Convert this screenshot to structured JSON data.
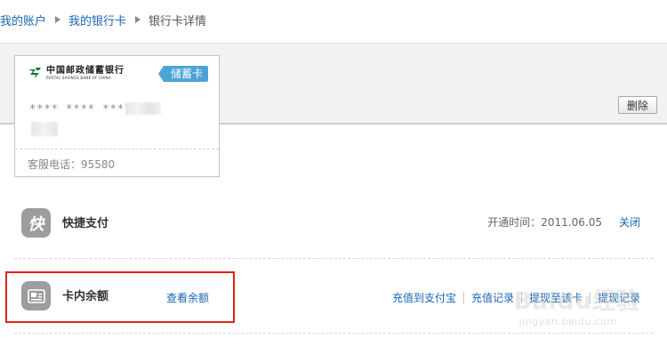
{
  "breadcrumb": {
    "items": [
      {
        "label": "我的账户"
      },
      {
        "label": "我的银行卡"
      },
      {
        "label": "银行卡详情"
      }
    ]
  },
  "toolbar": {
    "delete_label": "删除"
  },
  "card": {
    "bank_name_cn": "中国邮政储蓄银行",
    "bank_name_en": "POSTAL SAVINGS BANK OF CHINA",
    "type_label": "储蓄卡",
    "number_masked": "**** **** ****",
    "service_phone": "客服电话：95580"
  },
  "quick_pay": {
    "title": "快捷支付",
    "icon_char": "快",
    "open_time": "开通时间：2011.06.05",
    "close_label": "关闭"
  },
  "balance": {
    "title": "卡内余额",
    "view_label": "查看余额",
    "actions": [
      {
        "label": "充值到支付宝"
      },
      {
        "label": "充值记录"
      },
      {
        "label": "提现至该卡"
      },
      {
        "label": "提现记录"
      }
    ]
  },
  "watermark": {
    "main": "Baidu经验",
    "sub": "jingyan.baidu.com"
  },
  "colors": {
    "link": "#1a64b0",
    "card_tag": "#4ca3d6",
    "highlight": "#e2231a",
    "icon_bg": "#9d9d9d"
  }
}
